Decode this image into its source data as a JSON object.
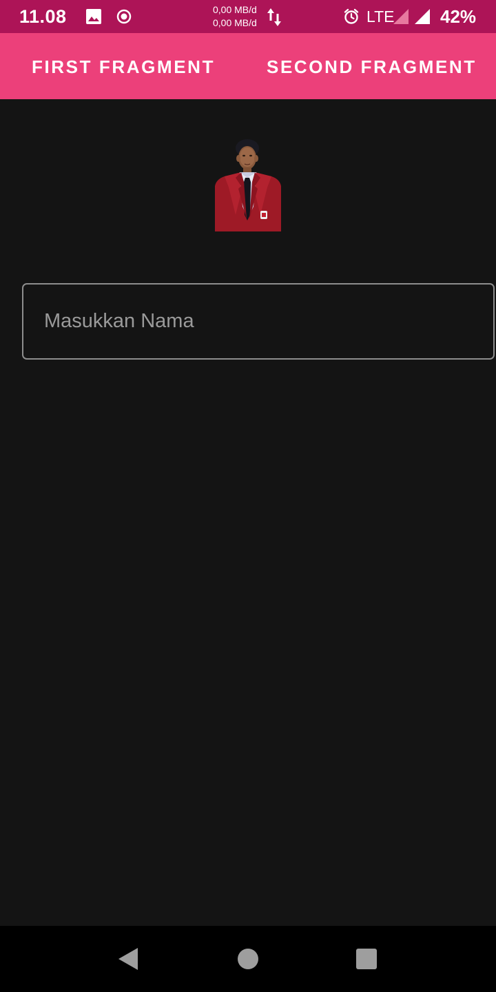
{
  "status_bar": {
    "time": "11.08",
    "upload_speed": "0,00 MB/d",
    "download_speed": "0,00 MB/d",
    "network_type": "LTE",
    "battery": "42%",
    "icons": [
      "image-icon",
      "record-icon",
      "data-transfer-icon",
      "alarm-icon",
      "signal-icon",
      "signal-full-icon"
    ]
  },
  "tabs": [
    {
      "label": "FIRST FRAGMENT",
      "selected": true
    },
    {
      "label": "SECOND FRAGMENT",
      "selected": false
    }
  ],
  "form": {
    "name_placeholder": "Masukkan Nama",
    "name_value": ""
  },
  "nav_bar": {
    "icons": [
      "back-icon",
      "home-icon",
      "recents-icon"
    ]
  },
  "colors": {
    "status_bar": "#ad1457",
    "tab_bar": "#ec407a",
    "background": "#141414",
    "nav_bar": "#000000"
  }
}
